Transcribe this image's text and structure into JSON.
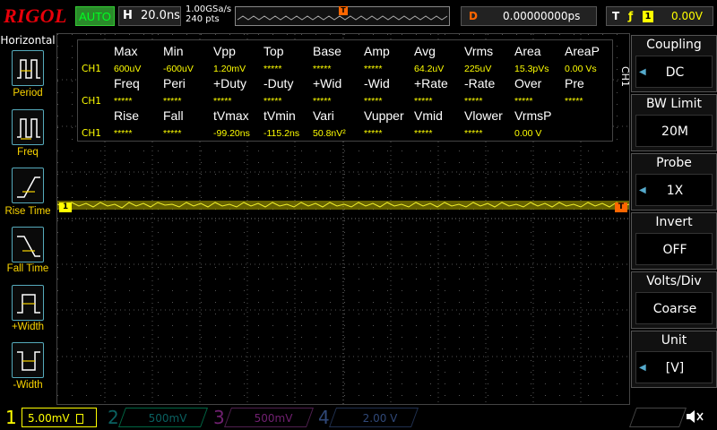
{
  "brand": "RIGOL",
  "run_state": "AUTO",
  "horizontal": {
    "label": "H",
    "value": "20.0ns"
  },
  "sampling": {
    "rate": "1.00GSa/s",
    "points": "240 pts"
  },
  "delay": {
    "label": "D",
    "value": "0.00000000ps"
  },
  "trigger": {
    "label": "T",
    "edge": "ƒ",
    "source": "1",
    "level": "0.00V",
    "marker": "T"
  },
  "left_menu": {
    "title": "Horizontal",
    "items": [
      {
        "label": "Period",
        "icon": "period-icon"
      },
      {
        "label": "Freq",
        "icon": "freq-icon"
      },
      {
        "label": "Rise Time",
        "icon": "rise-time-icon"
      },
      {
        "label": "Fall Time",
        "icon": "fall-time-icon"
      },
      {
        "label": "+Width",
        "icon": "pos-width-icon"
      },
      {
        "label": "-Width",
        "icon": "neg-width-icon"
      }
    ]
  },
  "measurements": {
    "channel": "CH1",
    "rows": [
      {
        "headers": [
          "Max",
          "Min",
          "Vpp",
          "Top",
          "Base",
          "Amp",
          "Avg",
          "Vrms",
          "Area",
          "AreaP"
        ],
        "values": [
          "600uV",
          "-600uV",
          "1.20mV",
          "*****",
          "*****",
          "*****",
          "64.2uV",
          "225uV",
          "15.3pVs",
          "0.00 Vs"
        ]
      },
      {
        "headers": [
          "Freq",
          "Peri",
          "+Duty",
          "-Duty",
          "+Wid",
          "-Wid",
          "+Rate",
          "-Rate",
          "Over",
          "Pre"
        ],
        "values": [
          "*****",
          "*****",
          "*****",
          "*****",
          "*****",
          "*****",
          "*****",
          "*****",
          "*****",
          "*****"
        ]
      },
      {
        "headers": [
          "Rise",
          "Fall",
          "tVmax",
          "tVmin",
          "Vari",
          "Vupper",
          "Vmid",
          "Vlower",
          "VrmsP",
          ""
        ],
        "values": [
          "*****",
          "*****",
          "-99.20ns",
          "-115.2ns",
          "50.8nV²",
          "*****",
          "*****",
          "*****",
          "0.00 V",
          ""
        ]
      }
    ]
  },
  "channel_marker": "1",
  "trigger_level_marker": "T",
  "right_menu": {
    "channel_label": "CH1",
    "items": [
      {
        "title": "Coupling",
        "value": "DC"
      },
      {
        "title": "BW Limit",
        "value": "20M"
      },
      {
        "title": "Probe",
        "value": "1X"
      },
      {
        "title": "Invert",
        "value": "OFF"
      },
      {
        "title": "Volts/Div",
        "value": "Coarse"
      },
      {
        "title": "Unit",
        "value": "[V]"
      }
    ]
  },
  "channels": [
    {
      "num": "1",
      "scale": "5.00mV",
      "color": "#ffff00"
    },
    {
      "num": "2",
      "scale": "500mV",
      "color": "#00c8c8"
    },
    {
      "num": "3",
      "scale": "500mV",
      "color": "#ff00ff"
    },
    {
      "num": "4",
      "scale": "2.00 V",
      "color": "#3080ff"
    }
  ],
  "colors": {
    "ch1": "#ffff00",
    "accent": "#fbd500",
    "trigger": "#ff6600",
    "brand": "#e8000a"
  }
}
